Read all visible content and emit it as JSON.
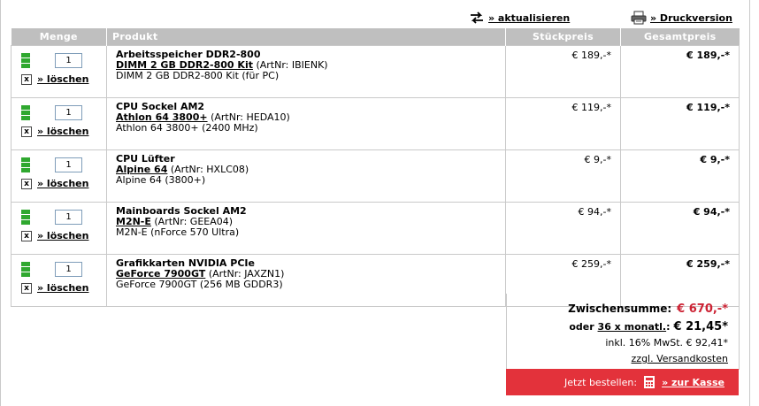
{
  "toolbar": {
    "refresh_label": "» aktualisieren",
    "print_label": "» Druckversion",
    "refresh_icon": "refresh-icon",
    "print_icon": "printer-icon"
  },
  "columns": {
    "qty": "Menge",
    "product": "Produkt",
    "unit_price": "Stückpreis",
    "total_price": "Gesamtpreis"
  },
  "delete_label": "» löschen",
  "delete_box": "x",
  "items": [
    {
      "qty": "1",
      "category": "Arbeitsspeicher DDR2-800",
      "name": "DIMM 2 GB DDR2-800 Kit",
      "artnr": "(ArtNr: IBIENK)",
      "desc": "DIMM 2 GB DDR2-800 Kit (für PC)",
      "unit_price": "€ 189,-*",
      "total_price": "€ 189,-*"
    },
    {
      "qty": "1",
      "category": "CPU Sockel AM2",
      "name": "Athlon 64 3800+",
      "artnr": "(ArtNr: HEDA10)",
      "desc": "Athlon 64 3800+ (2400 MHz)",
      "unit_price": "€ 119,-*",
      "total_price": "€ 119,-*"
    },
    {
      "qty": "1",
      "category": "CPU Lüfter",
      "name": "Alpine 64",
      "artnr": "(ArtNr: HXLC08)",
      "desc": "Alpine 64 (3800+)",
      "unit_price": "€ 9,-*",
      "total_price": "€ 9,-*"
    },
    {
      "qty": "1",
      "category": "Mainboards Sockel AM2",
      "name": "M2N-E",
      "artnr": "(ArtNr: GEEA04)",
      "desc": "M2N-E (nForce 570 Ultra)",
      "unit_price": "€ 94,-*",
      "total_price": "€ 94,-*"
    },
    {
      "qty": "1",
      "category": "Grafikkarten NVIDIA PCIe",
      "name": "GeForce 7900GT",
      "artnr": "(ArtNr: JAXZN1)",
      "desc": "GeForce 7900GT (256 MB GDDR3)",
      "unit_price": "€ 259,-*",
      "total_price": "€ 259,-*"
    }
  ],
  "summary": {
    "subtotal_label": "Zwischensumme:",
    "subtotal_value": "€ 670,-*",
    "finance_prefix": "oder",
    "finance_link": "36 x monatl.",
    "finance_colon": ":",
    "finance_value": "€ 21,45*",
    "vat_text": "inkl. 16% MwSt. € 92,41*",
    "shipping_link": "zzgl. Versandkosten"
  },
  "checkout": {
    "label": "Jetzt bestellen:",
    "button_label": "» zur Kasse",
    "icon": "calculator-icon"
  },
  "colors": {
    "header_bg": "#bfbfbf",
    "accent_red": "#e3323b",
    "price_red": "#cc2233",
    "stock_green": "#2fa82f"
  }
}
